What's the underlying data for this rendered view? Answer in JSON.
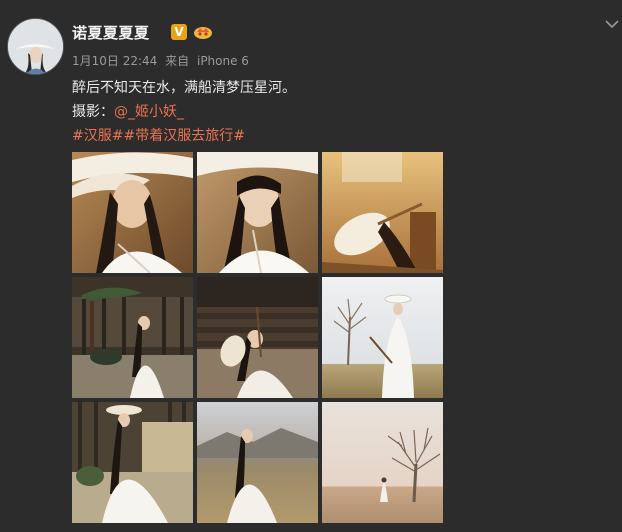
{
  "user": {
    "name": "诺夏夏夏夏",
    "vip_badge": "V"
  },
  "meta": {
    "time": "1月10日 22:44",
    "source_prefix": "来自",
    "device": "iPhone 6"
  },
  "content": {
    "text": "醉后不知天在水，满船清梦压星河。",
    "photo_label": "摄影：",
    "photographer": "@_姬小妖_",
    "topics": [
      "#汉服#",
      "#带着汉服去旅行#"
    ]
  },
  "photos": [
    {
      "icon": "hanfu-portrait-hat-closeup"
    },
    {
      "icon": "hanfu-portrait-hat-closeup-2"
    },
    {
      "icon": "hanfu-hat-held-warm"
    },
    {
      "icon": "hanfu-courtyard-bonsai"
    },
    {
      "icon": "hanfu-terrace-crouch"
    },
    {
      "icon": "hanfu-sword-tree-field"
    },
    {
      "icon": "hanfu-hat-garden"
    },
    {
      "icon": "hanfu-mountain-field"
    },
    {
      "icon": "hanfu-lone-tree-sunset"
    }
  ],
  "colors": {
    "background": "#2c2c2c",
    "accent": "#eb7350",
    "username": "#f2f2f2",
    "meta": "#9a9a9a"
  }
}
